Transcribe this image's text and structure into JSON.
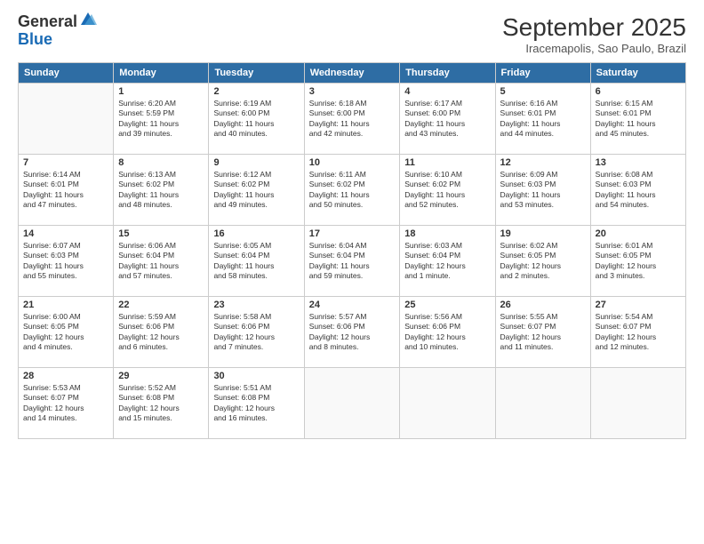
{
  "logo": {
    "general": "General",
    "blue": "Blue",
    "icon_color": "#1a6bb5"
  },
  "header": {
    "month": "September 2025",
    "location": "Iracemapolis, Sao Paulo, Brazil"
  },
  "weekdays": [
    "Sunday",
    "Monday",
    "Tuesday",
    "Wednesday",
    "Thursday",
    "Friday",
    "Saturday"
  ],
  "weeks": [
    [
      {
        "day": "",
        "info": ""
      },
      {
        "day": "1",
        "info": "Sunrise: 6:20 AM\nSunset: 5:59 PM\nDaylight: 11 hours\nand 39 minutes."
      },
      {
        "day": "2",
        "info": "Sunrise: 6:19 AM\nSunset: 6:00 PM\nDaylight: 11 hours\nand 40 minutes."
      },
      {
        "day": "3",
        "info": "Sunrise: 6:18 AM\nSunset: 6:00 PM\nDaylight: 11 hours\nand 42 minutes."
      },
      {
        "day": "4",
        "info": "Sunrise: 6:17 AM\nSunset: 6:00 PM\nDaylight: 11 hours\nand 43 minutes."
      },
      {
        "day": "5",
        "info": "Sunrise: 6:16 AM\nSunset: 6:01 PM\nDaylight: 11 hours\nand 44 minutes."
      },
      {
        "day": "6",
        "info": "Sunrise: 6:15 AM\nSunset: 6:01 PM\nDaylight: 11 hours\nand 45 minutes."
      }
    ],
    [
      {
        "day": "7",
        "info": "Sunrise: 6:14 AM\nSunset: 6:01 PM\nDaylight: 11 hours\nand 47 minutes."
      },
      {
        "day": "8",
        "info": "Sunrise: 6:13 AM\nSunset: 6:02 PM\nDaylight: 11 hours\nand 48 minutes."
      },
      {
        "day": "9",
        "info": "Sunrise: 6:12 AM\nSunset: 6:02 PM\nDaylight: 11 hours\nand 49 minutes."
      },
      {
        "day": "10",
        "info": "Sunrise: 6:11 AM\nSunset: 6:02 PM\nDaylight: 11 hours\nand 50 minutes."
      },
      {
        "day": "11",
        "info": "Sunrise: 6:10 AM\nSunset: 6:02 PM\nDaylight: 11 hours\nand 52 minutes."
      },
      {
        "day": "12",
        "info": "Sunrise: 6:09 AM\nSunset: 6:03 PM\nDaylight: 11 hours\nand 53 minutes."
      },
      {
        "day": "13",
        "info": "Sunrise: 6:08 AM\nSunset: 6:03 PM\nDaylight: 11 hours\nand 54 minutes."
      }
    ],
    [
      {
        "day": "14",
        "info": "Sunrise: 6:07 AM\nSunset: 6:03 PM\nDaylight: 11 hours\nand 55 minutes."
      },
      {
        "day": "15",
        "info": "Sunrise: 6:06 AM\nSunset: 6:04 PM\nDaylight: 11 hours\nand 57 minutes."
      },
      {
        "day": "16",
        "info": "Sunrise: 6:05 AM\nSunset: 6:04 PM\nDaylight: 11 hours\nand 58 minutes."
      },
      {
        "day": "17",
        "info": "Sunrise: 6:04 AM\nSunset: 6:04 PM\nDaylight: 11 hours\nand 59 minutes."
      },
      {
        "day": "18",
        "info": "Sunrise: 6:03 AM\nSunset: 6:04 PM\nDaylight: 12 hours\nand 1 minute."
      },
      {
        "day": "19",
        "info": "Sunrise: 6:02 AM\nSunset: 6:05 PM\nDaylight: 12 hours\nand 2 minutes."
      },
      {
        "day": "20",
        "info": "Sunrise: 6:01 AM\nSunset: 6:05 PM\nDaylight: 12 hours\nand 3 minutes."
      }
    ],
    [
      {
        "day": "21",
        "info": "Sunrise: 6:00 AM\nSunset: 6:05 PM\nDaylight: 12 hours\nand 4 minutes."
      },
      {
        "day": "22",
        "info": "Sunrise: 5:59 AM\nSunset: 6:06 PM\nDaylight: 12 hours\nand 6 minutes."
      },
      {
        "day": "23",
        "info": "Sunrise: 5:58 AM\nSunset: 6:06 PM\nDaylight: 12 hours\nand 7 minutes."
      },
      {
        "day": "24",
        "info": "Sunrise: 5:57 AM\nSunset: 6:06 PM\nDaylight: 12 hours\nand 8 minutes."
      },
      {
        "day": "25",
        "info": "Sunrise: 5:56 AM\nSunset: 6:06 PM\nDaylight: 12 hours\nand 10 minutes."
      },
      {
        "day": "26",
        "info": "Sunrise: 5:55 AM\nSunset: 6:07 PM\nDaylight: 12 hours\nand 11 minutes."
      },
      {
        "day": "27",
        "info": "Sunrise: 5:54 AM\nSunset: 6:07 PM\nDaylight: 12 hours\nand 12 minutes."
      }
    ],
    [
      {
        "day": "28",
        "info": "Sunrise: 5:53 AM\nSunset: 6:07 PM\nDaylight: 12 hours\nand 14 minutes."
      },
      {
        "day": "29",
        "info": "Sunrise: 5:52 AM\nSunset: 6:08 PM\nDaylight: 12 hours\nand 15 minutes."
      },
      {
        "day": "30",
        "info": "Sunrise: 5:51 AM\nSunset: 6:08 PM\nDaylight: 12 hours\nand 16 minutes."
      },
      {
        "day": "",
        "info": ""
      },
      {
        "day": "",
        "info": ""
      },
      {
        "day": "",
        "info": ""
      },
      {
        "day": "",
        "info": ""
      }
    ]
  ]
}
